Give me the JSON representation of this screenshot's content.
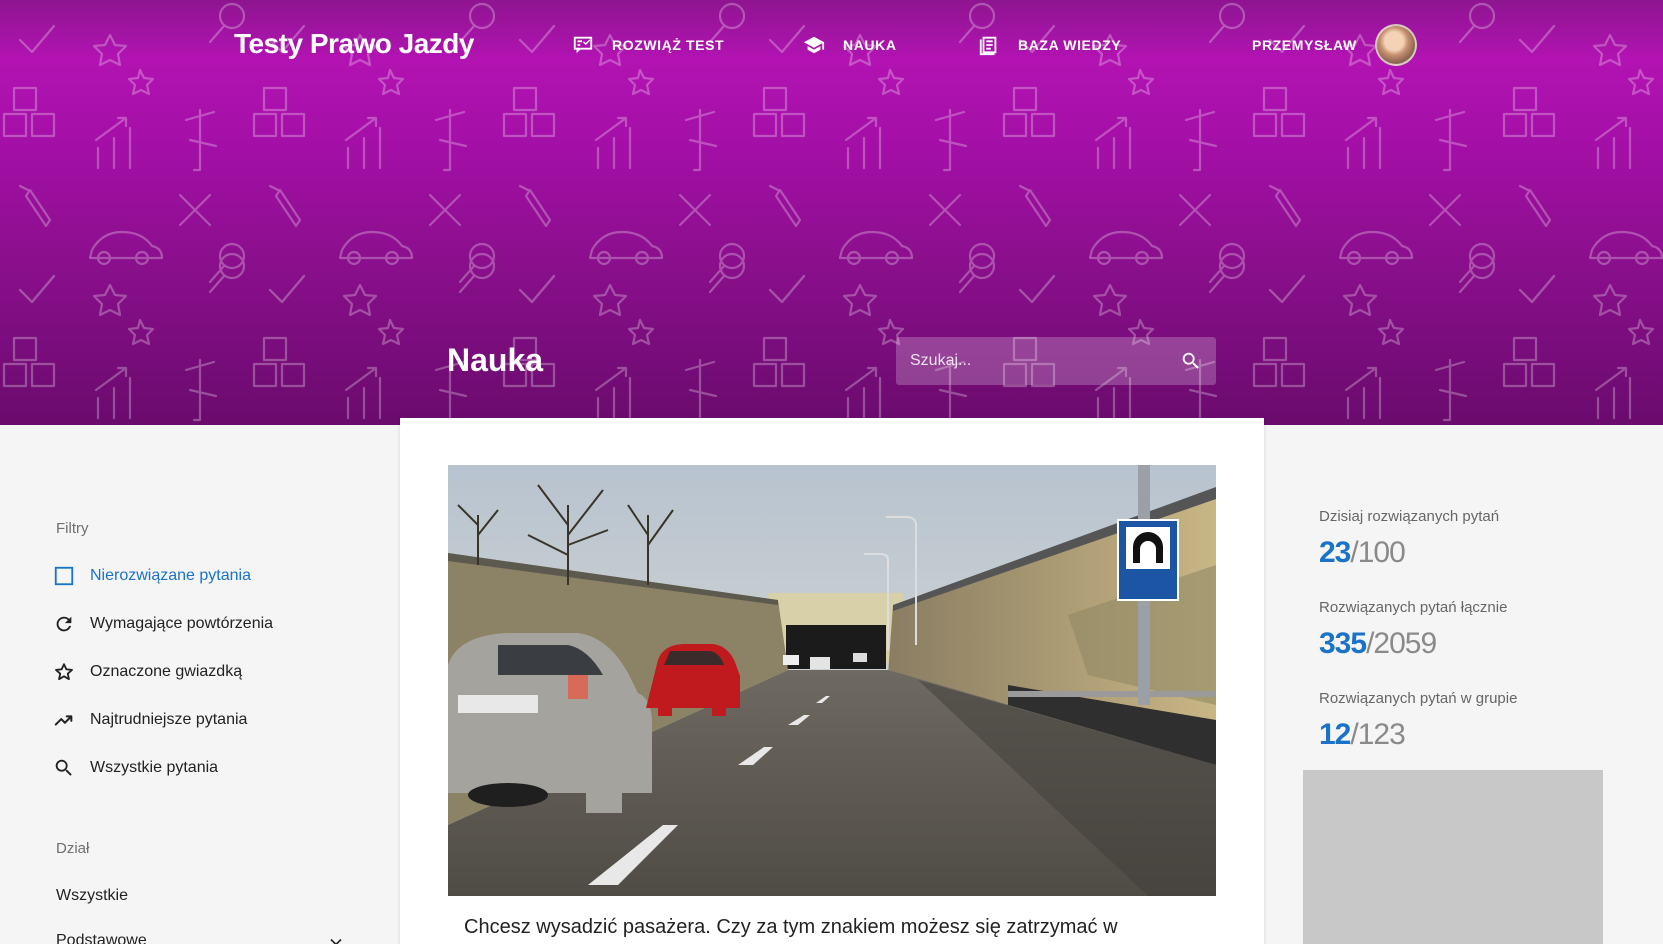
{
  "header": {
    "logo": "Testy Prawo Jazdy",
    "nav": [
      {
        "label": "ROZWIĄŻ TEST",
        "icon": "quiz-board-icon"
      },
      {
        "label": "NAUKA",
        "icon": "graduation-cap-icon"
      },
      {
        "label": "BAZA WIEDZY",
        "icon": "document-list-icon"
      }
    ],
    "user": {
      "name": "PRZEMYSŁAW",
      "avatar": "avatar"
    },
    "page_title": "Nauka",
    "search": {
      "placeholder": "Szukaj..."
    }
  },
  "sidebar": {
    "filters_title": "Filtry",
    "filters": [
      {
        "label": "Nierozwiązane pytania",
        "icon": "checkbox-icon",
        "active": true
      },
      {
        "label": "Wymagające powtórzenia",
        "icon": "refresh-icon",
        "active": false
      },
      {
        "label": "Oznaczone gwiazdką",
        "icon": "star-icon",
        "active": false
      },
      {
        "label": "Najtrudniejsze pytania",
        "icon": "trending-up-icon",
        "active": false
      },
      {
        "label": "Wszystkie pytania",
        "icon": "search-icon",
        "active": false
      }
    ],
    "dept_title": "Dział",
    "departments": [
      {
        "label": "Wszystkie"
      },
      {
        "label": "Podstawowe",
        "icon": "chevron-down-icon"
      }
    ]
  },
  "main": {
    "image_alt": "Droga prowadząca do tunelu, znak tunel",
    "question": "Chcesz wysadzić pasażera. Czy za tym znakiem możesz się zatrzymać w"
  },
  "stats": [
    {
      "label": "Dzisiaj rozwiązanych pytań",
      "value": "23",
      "total": "100"
    },
    {
      "label": "Rozwiązanych pytań łącznie",
      "value": "335",
      "total": "2059"
    },
    {
      "label": "Rozwiązanych pytań w grupie",
      "value": "12",
      "total": "123"
    }
  ],
  "colors": {
    "accent_blue": "#1a73c8",
    "hero_purple": "#a30fa6"
  }
}
